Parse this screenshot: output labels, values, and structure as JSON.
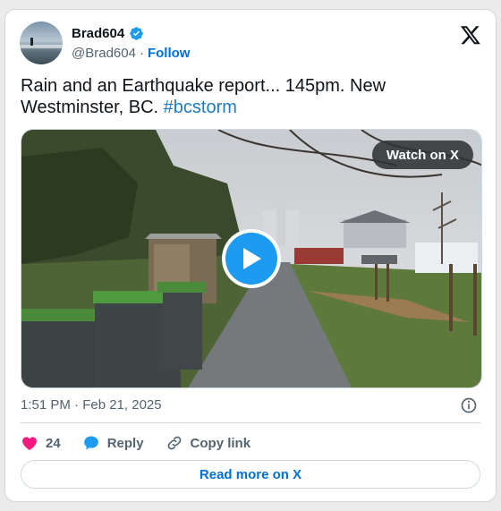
{
  "author": {
    "display_name": "Brad604",
    "handle": "@Brad604",
    "separator": "·",
    "follow_label": "Follow"
  },
  "tweet": {
    "text_main": "Rain and an Earthquake report... 145pm. New Westminster, BC. ",
    "hashtag": "#bcstorm",
    "timestamp": "1:51 PM · Feb 21, 2025"
  },
  "media": {
    "watch_label": "Watch on X",
    "type": "video"
  },
  "actions": {
    "like_count": "24",
    "reply_label": "Reply",
    "copy_link_label": "Copy link"
  },
  "footer": {
    "read_more_label": "Read more on X"
  },
  "colors": {
    "accent": "#1d9bf0",
    "link": "#006fd6",
    "like": "#f91880",
    "text_secondary": "#536471"
  },
  "icons": [
    "verified-badge-icon",
    "x-logo-icon",
    "play-icon",
    "info-icon",
    "heart-icon",
    "reply-bubble-icon",
    "link-icon"
  ]
}
